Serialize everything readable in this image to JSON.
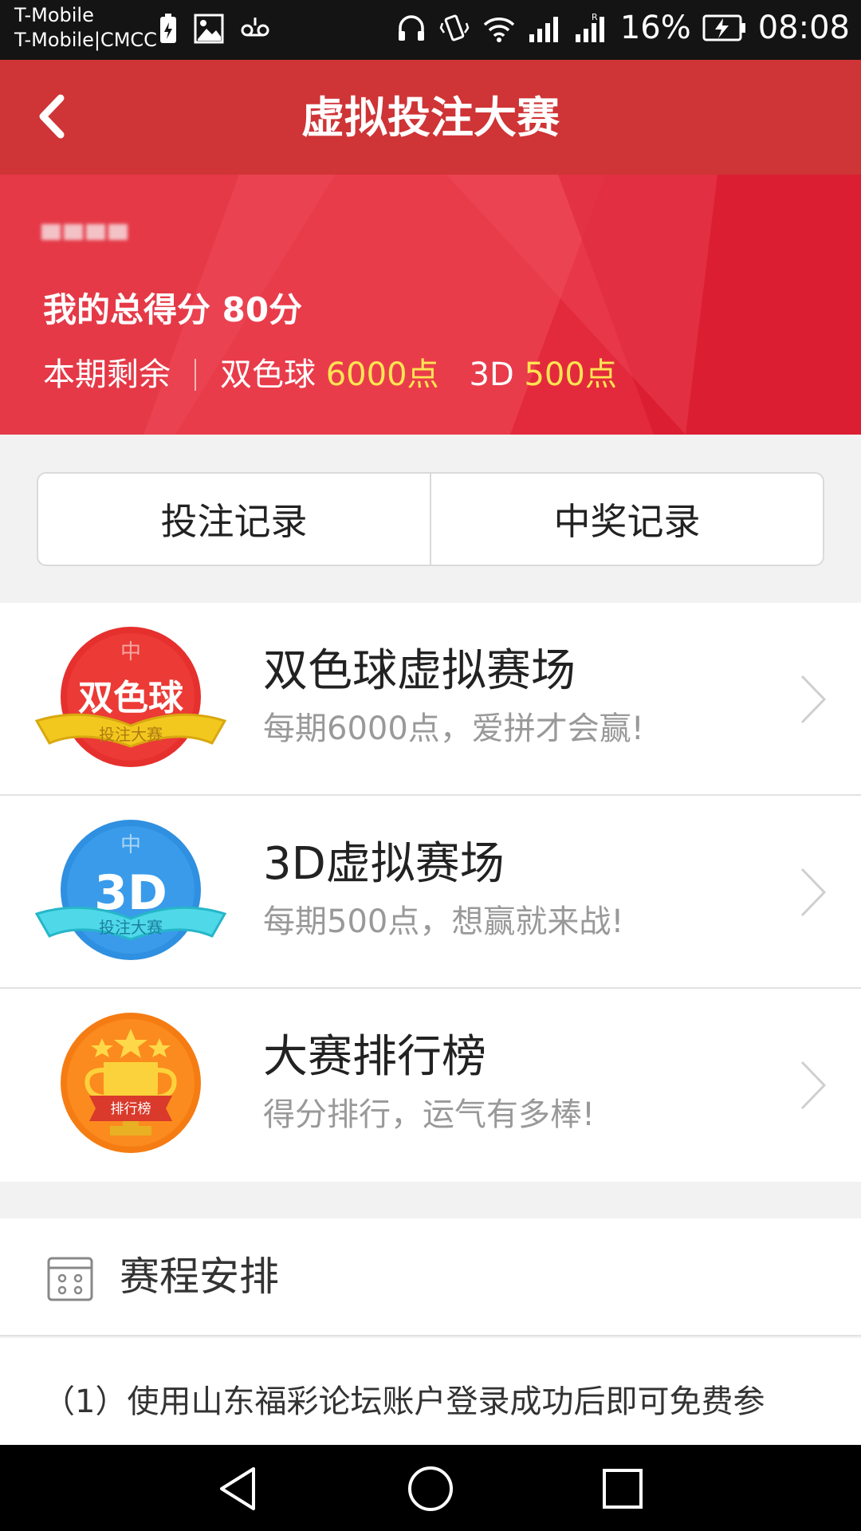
{
  "status_bar": {
    "carrier1": "T-Mobile",
    "carrier2": "T-Mobile|CMCC",
    "battery": "16%",
    "time": "08:08"
  },
  "header": {
    "title": "虚拟投注大赛"
  },
  "banner": {
    "score_label": "我的总得分",
    "score_value": "80分",
    "remain_label": "本期剩余",
    "ssq_label": "双色球",
    "ssq_value": "6000点",
    "d3_label": "3D",
    "d3_value": "500点"
  },
  "tabs": [
    "投注记录",
    "中奖记录"
  ],
  "games": [
    {
      "title": "双色球虚拟赛场",
      "subtitle": "每期6000点，爱拼才会赢!",
      "icon_text": "双色球",
      "ribbon": "投注大赛",
      "icon": "ssq-badge-icon"
    },
    {
      "title": "3D虚拟赛场",
      "subtitle": "每期500点，想赢就来战!",
      "icon_text": "3D",
      "ribbon": "投注大赛",
      "icon": "3d-badge-icon"
    },
    {
      "title": "大赛排行榜",
      "subtitle": "得分排行，运气有多棒!",
      "ribbon": "排行榜",
      "icon": "trophy-icon"
    }
  ],
  "schedule": {
    "title": "赛程安排",
    "rule1": "（1）使用山东福彩论坛账户登录成功后即可免费参"
  },
  "colors": {
    "header_red": "#cf3436",
    "banner_red": "#e32a3c",
    "highlight_yellow": "#ffe552"
  }
}
